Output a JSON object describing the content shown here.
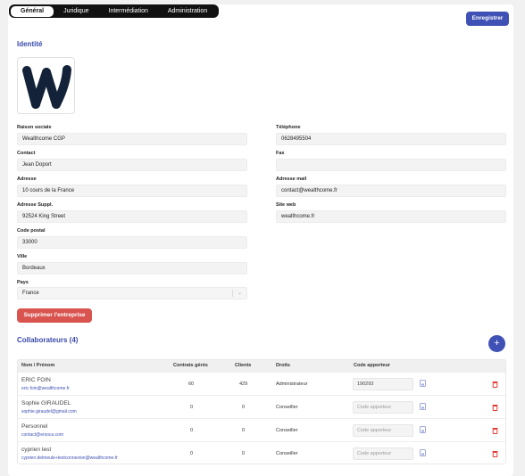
{
  "tabs": [
    "Général",
    "Juridique",
    "Intermédiation",
    "Administration"
  ],
  "toolbar": {
    "save_label": "Enregistrer"
  },
  "identity": {
    "title": "Identité",
    "fields": {
      "raison_sociale": {
        "label": "Raison sociale",
        "value": "Wealthcome CGP"
      },
      "contact": {
        "label": "Contact",
        "value": "Jean Doport"
      },
      "adresse": {
        "label": "Adresse",
        "value": "10 cours de la France"
      },
      "adresse_suppl": {
        "label": "Adresse Suppl.",
        "value": "92524 King Street"
      },
      "code_postal": {
        "label": "Code postal",
        "value": "33000"
      },
      "ville": {
        "label": "Ville",
        "value": "Bordeaux"
      },
      "pays": {
        "label": "Pays",
        "value": "France"
      },
      "telephone": {
        "label": "Téléphone",
        "value": "0628495504"
      },
      "fax": {
        "label": "Fax",
        "value": ""
      },
      "adresse_mail": {
        "label": "Adresse mail",
        "value": "contact@wealthcome.fr"
      },
      "site_web": {
        "label": "Site web",
        "value": "wealthcome.fr"
      }
    },
    "delete_label": "Supprimer l'entreprise"
  },
  "collaborators": {
    "title": "Collaborateurs (4)",
    "add_label": "+",
    "headers": [
      "Nom / Prénom",
      "Contrats gérés",
      "Clients",
      "Droits",
      "Code apporteur"
    ],
    "code_placeholder": "Code apporteur",
    "rows": [
      {
        "name": "ERIC FOIN",
        "email": "eric.foin@wealthcome.fr",
        "contracts": "60",
        "clients": "429",
        "rights": "Administrateur",
        "code": "190293"
      },
      {
        "name": "Sophie GIRAUDEL",
        "email": "sophie.giraudel@gmail.com",
        "contracts": "0",
        "clients": "0",
        "rights": "Conseiller",
        "code": ""
      },
      {
        "name": "Personnel",
        "email": "contact@ersoca.com",
        "contracts": "0",
        "clients": "0",
        "rights": "Conseiller",
        "code": ""
      },
      {
        "name": "cyprien test",
        "email": "cyprien.delmeule+testconnexion@wealthcome.fr",
        "contracts": "0",
        "clients": "0",
        "rights": "Conseiller",
        "code": ""
      }
    ]
  },
  "colors": {
    "accent": "#3f51b5",
    "danger": "#d9534f",
    "tab_bar": "#111111"
  }
}
